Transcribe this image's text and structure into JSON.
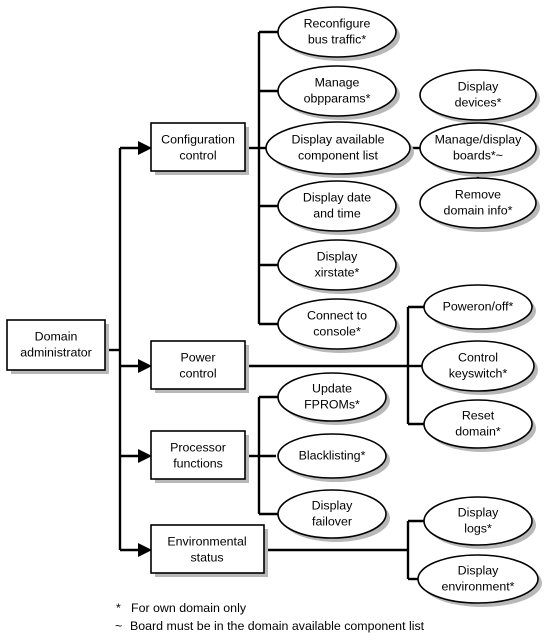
{
  "diagram": {
    "title": "Domain administrator",
    "root": {
      "id": "domain-administrator",
      "label_lines": [
        "Domain",
        "administrator"
      ]
    },
    "categories": [
      {
        "id": "configuration-control",
        "label_lines": [
          "Configuration",
          "control"
        ]
      },
      {
        "id": "power-control",
        "label_lines": [
          "Power",
          "control"
        ]
      },
      {
        "id": "processor-functions",
        "label_lines": [
          "Processor",
          "functions"
        ]
      },
      {
        "id": "environmental-status",
        "label_lines": [
          "Environmental",
          "status"
        ]
      }
    ],
    "configuration_tasks": [
      {
        "id": "reconfigure-bus-traffic",
        "label_lines": [
          "Reconfigure",
          "bus traffic*"
        ]
      },
      {
        "id": "manage-obpparams",
        "label_lines": [
          "Manage",
          "obpparams*"
        ]
      },
      {
        "id": "display-available-component-list",
        "label_lines": [
          "Display available",
          "component list"
        ]
      },
      {
        "id": "display-date-and-time",
        "label_lines": [
          "Display date",
          "and time"
        ]
      },
      {
        "id": "display-xirstate",
        "label_lines": [
          "Display",
          "xirstate*"
        ]
      },
      {
        "id": "connect-to-console",
        "label_lines": [
          "Connect to",
          "console*"
        ]
      }
    ],
    "component_list_tasks": [
      {
        "id": "display-devices",
        "label_lines": [
          "Display",
          "devices*"
        ]
      },
      {
        "id": "manage-display-boards",
        "label_lines": [
          "Manage/display",
          "boards*~"
        ]
      },
      {
        "id": "remove-domain-info",
        "label_lines": [
          "Remove",
          "domain info*"
        ]
      }
    ],
    "power_tasks": [
      {
        "id": "poweron-off",
        "label_lines": [
          "Poweron/off*"
        ]
      },
      {
        "id": "control-keyswitch",
        "label_lines": [
          "Control",
          "keyswitch*"
        ]
      },
      {
        "id": "reset-domain",
        "label_lines": [
          "Reset",
          "domain*"
        ]
      }
    ],
    "processor_tasks": [
      {
        "id": "update-fproms",
        "label_lines": [
          "Update",
          "FPROMs*"
        ]
      },
      {
        "id": "blacklisting",
        "label_lines": [
          "Blacklisting*"
        ]
      },
      {
        "id": "display-failover",
        "label_lines": [
          "Display",
          "failover"
        ]
      }
    ],
    "environmental_tasks": [
      {
        "id": "display-logs",
        "label_lines": [
          "Display",
          "logs*"
        ]
      },
      {
        "id": "display-environment",
        "label_lines": [
          "Display",
          "environment*"
        ]
      }
    ],
    "legend": [
      {
        "id": "legend-asterisk",
        "mark": "*",
        "text": "For own domain only"
      },
      {
        "id": "legend-tilde",
        "mark": "~",
        "text": "Board must be in the domain available component list"
      }
    ],
    "colors": {
      "background": "#ffffff",
      "stroke": "#000000",
      "fill": "#ffffff",
      "shadow": "#b8b8b8"
    }
  }
}
